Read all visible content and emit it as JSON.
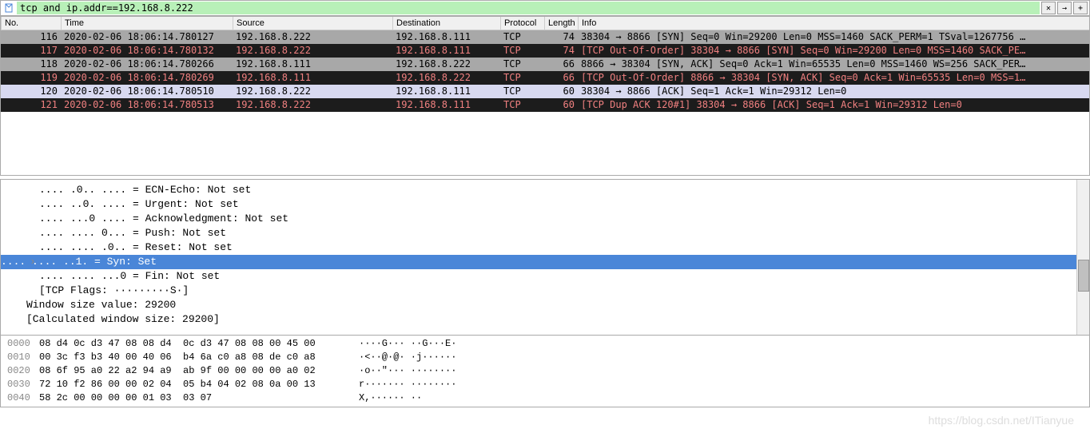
{
  "filter": {
    "value": "tcp and ip.addr==192.168.8.222",
    "clear_label": "✕",
    "apply_label": "→",
    "plus_label": "+"
  },
  "columns": {
    "no": "No.",
    "time": "Time",
    "source": "Source",
    "destination": "Destination",
    "protocol": "Protocol",
    "length": "Length",
    "info": "Info"
  },
  "packets": [
    {
      "no": "116",
      "time": "2020-02-06 18:06:14.780127",
      "src": "192.168.8.222",
      "dst": "192.168.8.111",
      "proto": "TCP",
      "len": "74",
      "info": "38304 → 8866 [SYN] Seq=0 Win=29200 Len=0 MSS=1460 SACK_PERM=1 TSval=1267756 …",
      "cls": "row-gray"
    },
    {
      "no": "117",
      "time": "2020-02-06 18:06:14.780132",
      "src": "192.168.8.222",
      "dst": "192.168.8.111",
      "proto": "TCP",
      "len": "74",
      "info": "[TCP Out-Of-Order] 38304 → 8866 [SYN] Seq=0 Win=29200 Len=0 MSS=1460 SACK_PE…",
      "cls": "row-dark"
    },
    {
      "no": "118",
      "time": "2020-02-06 18:06:14.780266",
      "src": "192.168.8.111",
      "dst": "192.168.8.222",
      "proto": "TCP",
      "len": "66",
      "info": "8866 → 38304 [SYN, ACK] Seq=0 Ack=1 Win=65535 Len=0 MSS=1460 WS=256 SACK_PER…",
      "cls": "row-gray"
    },
    {
      "no": "119",
      "time": "2020-02-06 18:06:14.780269",
      "src": "192.168.8.111",
      "dst": "192.168.8.222",
      "proto": "TCP",
      "len": "66",
      "info": "[TCP Out-Of-Order] 8866 → 38304 [SYN, ACK] Seq=0 Ack=1 Win=65535 Len=0 MSS=1…",
      "cls": "row-dark"
    },
    {
      "no": "120",
      "time": "2020-02-06 18:06:14.780510",
      "src": "192.168.8.222",
      "dst": "192.168.8.111",
      "proto": "TCP",
      "len": "60",
      "info": "38304 → 8866 [ACK] Seq=1 Ack=1 Win=29312 Len=0",
      "cls": "row-sel"
    },
    {
      "no": "121",
      "time": "2020-02-06 18:06:14.780513",
      "src": "192.168.8.222",
      "dst": "192.168.8.111",
      "proto": "TCP",
      "len": "60",
      "info": "[TCP Dup ACK 120#1] 38304 → 8866 [ACK] Seq=1 Ack=1 Win=29312 Len=0",
      "cls": "row-dark"
    }
  ],
  "tree": [
    ".... .0.. .... = ECN-Echo: Not set",
    ".... ..0. .... = Urgent: Not set",
    ".... ...0 .... = Acknowledgment: Not set",
    ".... .... 0... = Push: Not set",
    ".... .... .0.. = Reset: Not set",
    ".... .... ..1. = Syn: Set",
    ".... .... ...0 = Fin: Not set",
    "[TCP Flags: ·········S·]"
  ],
  "tree_tail": [
    "Window size value: 29200",
    "[Calculated window size: 29200]"
  ],
  "tree_selected_index": 5,
  "hex": [
    {
      "off": "0000",
      "bytes": "08 d4 0c d3 47 08 08 d4  0c d3 47 08 08 00 45 00",
      "ascii": "····G··· ··G···E·"
    },
    {
      "off": "0010",
      "bytes": "00 3c f3 b3 40 00 40 06  b4 6a c0 a8 08 de c0 a8",
      "ascii": "·<··@·@· ·j······"
    },
    {
      "off": "0020",
      "bytes": "08 6f 95 a0 22 a2 94 a9  ab 9f 00 00 00 00 a0 02",
      "ascii": "·o··\"··· ········"
    },
    {
      "off": "0030",
      "bytes": "72 10 f2 86 00 00 02 04  05 b4 04 02 08 0a 00 13",
      "ascii": "r······· ········"
    },
    {
      "off": "0040",
      "bytes": "58 2c 00 00 00 00 01 03  03 07",
      "ascii": "X,······ ··"
    }
  ],
  "watermark": "https://blog.csdn.net/ITianyue"
}
